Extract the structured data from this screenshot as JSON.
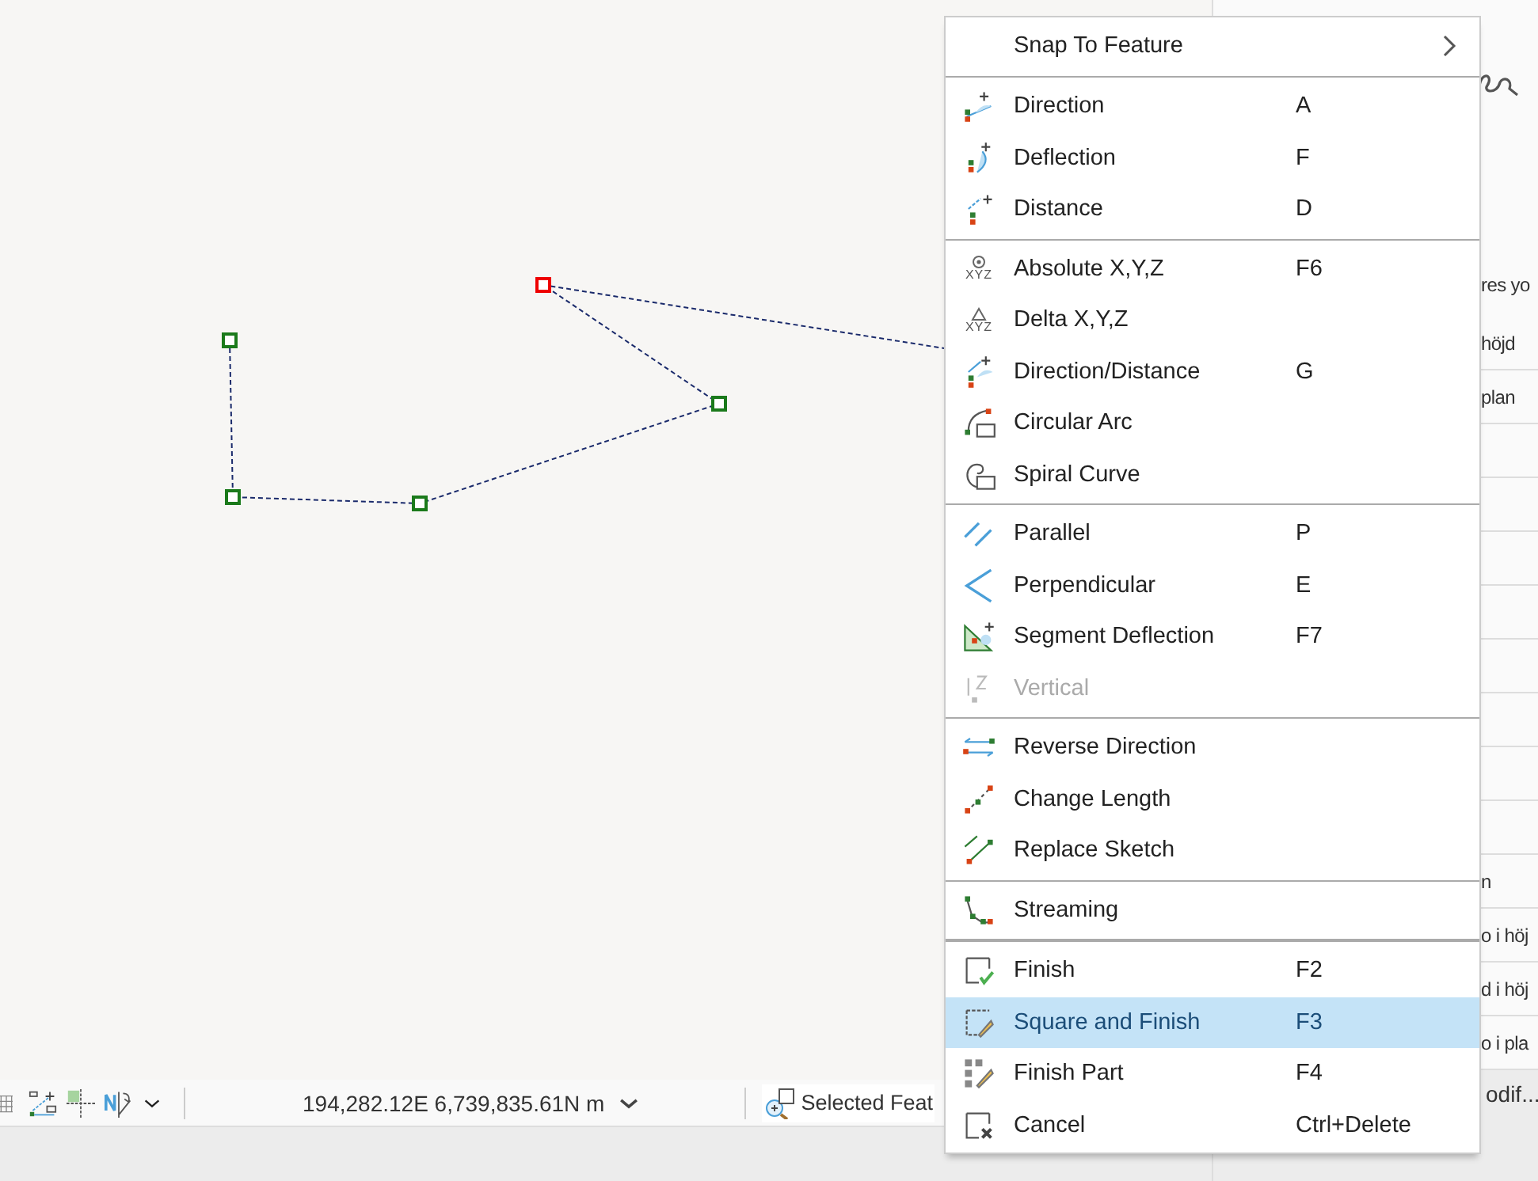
{
  "status_bar": {
    "coordinates": "194,282.12E 6,739,835.61N m",
    "selected_button": "Selected Feat"
  },
  "side_panel": {
    "heading": "res yo",
    "rows_top": [
      "höjd",
      "plan"
    ],
    "rows_bottom": [
      "n",
      "o i höj",
      "d i höj",
      "o i pla"
    ],
    "footer": "odif..."
  },
  "context_menu": {
    "sections": [
      [
        {
          "label": "Snap To Feature",
          "submenu": true,
          "disabled": false,
          "selected": false
        }
      ],
      [
        {
          "label": "Direction",
          "shortcut": "A",
          "disabled": false,
          "selected": false
        },
        {
          "label": "Deflection",
          "shortcut": "F",
          "disabled": false,
          "selected": false
        },
        {
          "label": "Distance",
          "shortcut": "D",
          "disabled": false,
          "selected": false
        }
      ],
      [
        {
          "label": "Absolute X,Y,Z",
          "shortcut": "F6",
          "icon_caption": "XYZ",
          "disabled": false,
          "selected": false
        },
        {
          "label": "Delta X,Y,Z",
          "icon_caption": "XYZ",
          "disabled": false,
          "selected": false
        },
        {
          "label": "Direction/Distance",
          "shortcut": "G",
          "disabled": false,
          "selected": false
        },
        {
          "label": "Circular Arc",
          "disabled": false,
          "selected": false
        },
        {
          "label": "Spiral Curve",
          "disabled": false,
          "selected": false
        }
      ],
      [
        {
          "label": "Parallel",
          "shortcut": "P",
          "disabled": false,
          "selected": false
        },
        {
          "label": "Perpendicular",
          "shortcut": "E",
          "disabled": false,
          "selected": false
        },
        {
          "label": "Segment Deflection",
          "shortcut": "F7",
          "disabled": false,
          "selected": false
        },
        {
          "label": "Vertical",
          "disabled": true,
          "selected": false
        }
      ],
      [
        {
          "label": "Reverse Direction",
          "disabled": false,
          "selected": false
        },
        {
          "label": "Change Length",
          "disabled": false,
          "selected": false
        },
        {
          "label": "Replace Sketch",
          "disabled": false,
          "selected": false
        }
      ],
      [
        {
          "label": "Streaming",
          "disabled": false,
          "selected": false
        }
      ],
      [
        {
          "label": "Finish",
          "shortcut": "F2",
          "disabled": false,
          "selected": false
        },
        {
          "label": "Square and Finish",
          "shortcut": "F3",
          "disabled": false,
          "selected": true
        },
        {
          "label": "Finish Part",
          "shortcut": "F4",
          "disabled": false,
          "selected": false
        },
        {
          "label": "Cancel",
          "shortcut": "Ctrl+Delete",
          "disabled": false,
          "selected": false
        }
      ]
    ]
  }
}
